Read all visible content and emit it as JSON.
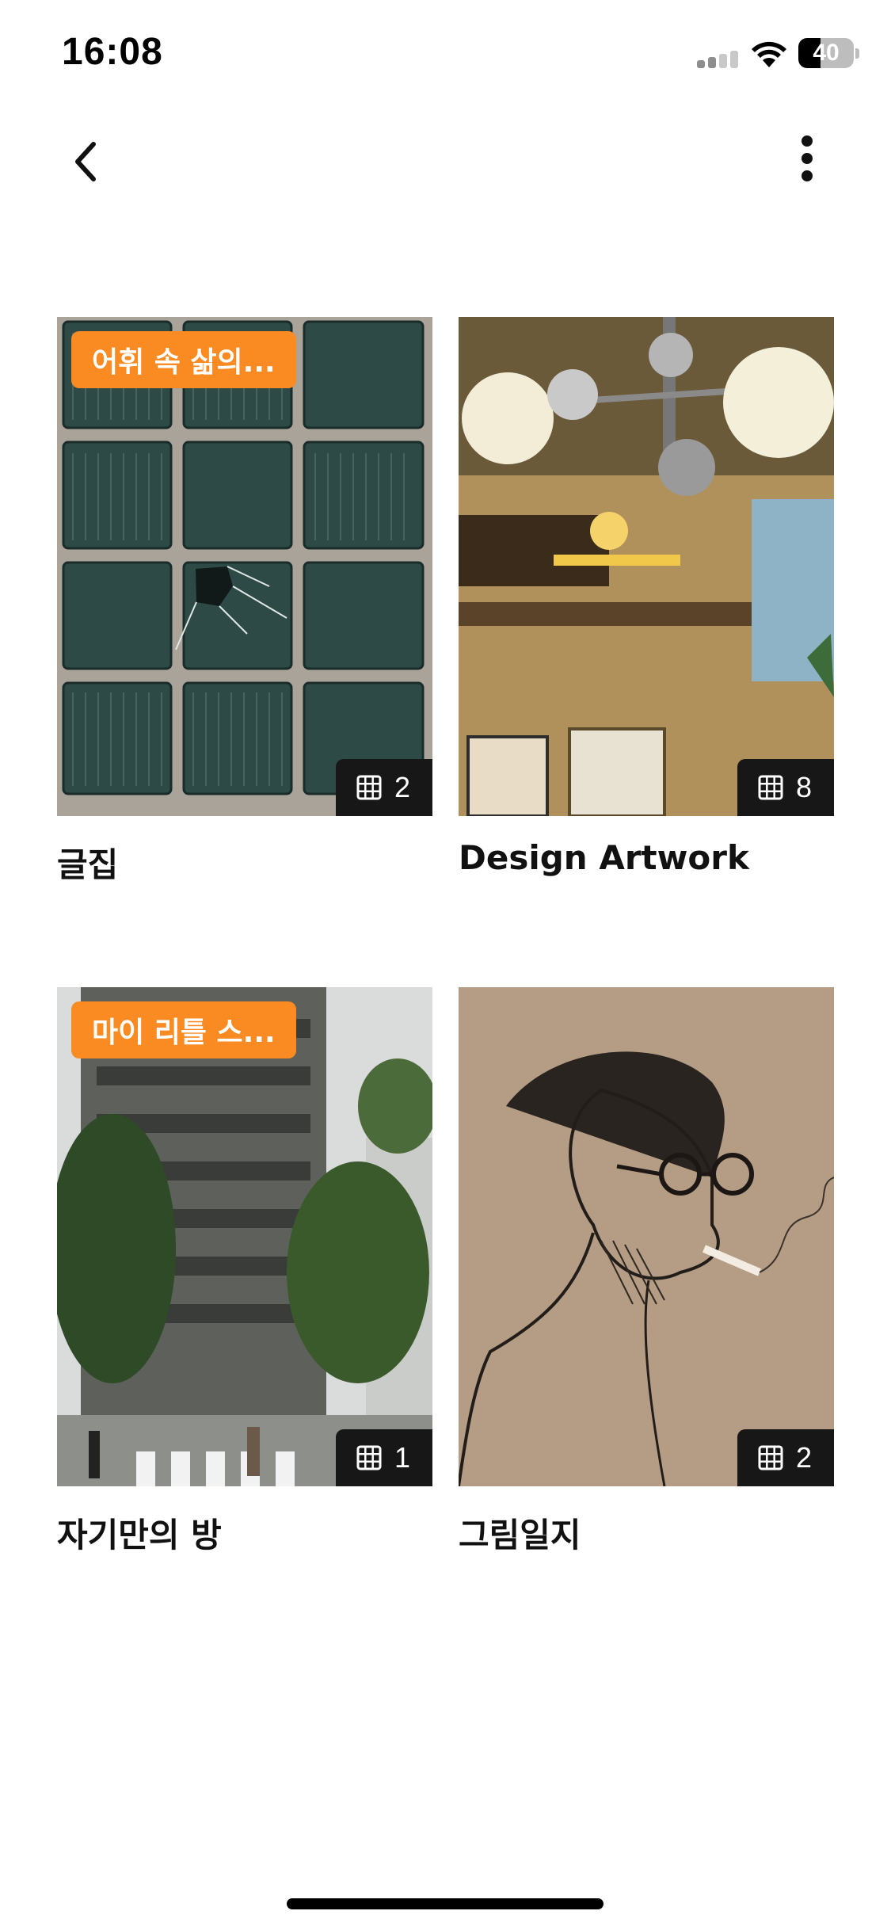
{
  "status_bar": {
    "time": "16:08",
    "battery_level": "40",
    "battery_fraction": 0.4,
    "signal_bars_active": 1,
    "signal_bars_total": 4
  },
  "nav": {
    "back_icon": "chevron-left-icon",
    "more_icon": "vertical-dots-icon"
  },
  "collections": [
    {
      "title": "글집",
      "tag": "어휘 속 삶의...",
      "count": "2",
      "thumbnail": "glass-block-wall"
    },
    {
      "title": "Design Artwork",
      "tag": "",
      "count": "8",
      "thumbnail": "cafe-interior-lamp"
    },
    {
      "title": "자기만의 방",
      "tag": "마이 리틀 스...",
      "count": "1",
      "thumbnail": "apartment-street"
    },
    {
      "title": "그림일지",
      "tag": "",
      "count": "2",
      "thumbnail": "ink-sketch-portrait"
    }
  ],
  "colors": {
    "tag_background": "#f98b22",
    "badge_background": "#171717",
    "title_text": "#111111",
    "background": "#ffffff"
  }
}
